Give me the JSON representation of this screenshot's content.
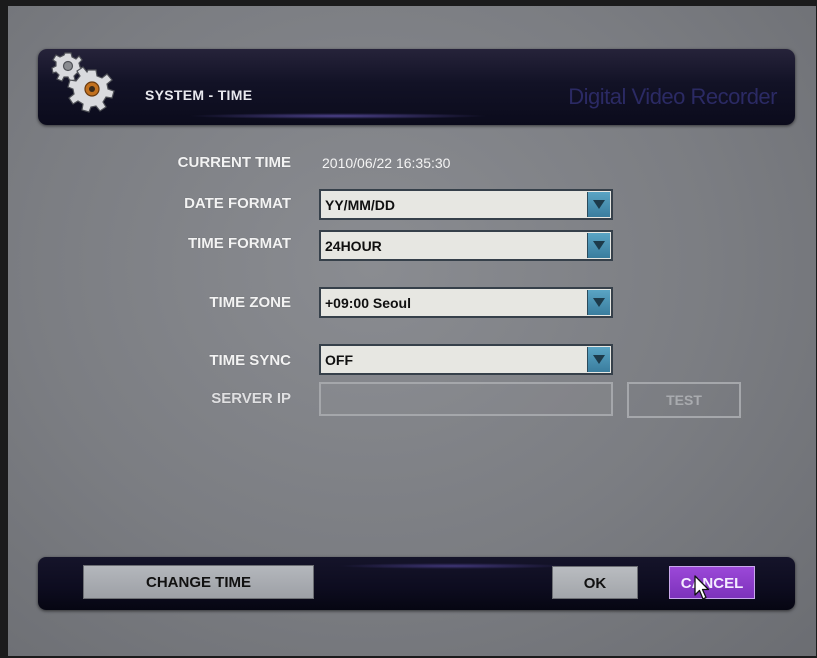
{
  "header": {
    "title": "SYSTEM - TIME",
    "brand": "Digital Video Recorder"
  },
  "form": {
    "current_time": {
      "label": "CURRENT TIME",
      "value": "2010/06/22 16:35:30"
    },
    "date_format": {
      "label": "DATE FORMAT",
      "value": "YY/MM/DD"
    },
    "time_format": {
      "label": "TIME FORMAT",
      "value": "24HOUR"
    },
    "time_zone": {
      "label": "TIME ZONE",
      "value": "+09:00 Seoul"
    },
    "time_sync": {
      "label": "TIME SYNC",
      "value": "OFF"
    },
    "server_ip": {
      "label": "SERVER IP",
      "value": ""
    },
    "test_label": "TEST"
  },
  "footer": {
    "change_time_label": "CHANGE TIME",
    "ok_label": "OK",
    "cancel_label": "CANCEL"
  },
  "icons": {
    "header_icon": "gears-icon",
    "dropdown_icon": "chevron-down-icon",
    "pointer": "mouse-cursor-icon"
  },
  "colors": {
    "panel_bg": "#7b7d82",
    "header_bg": "#0b0b1c",
    "dropdown_arrow": "#4a8fb0",
    "cancel_accent": "#8a3cc8"
  }
}
